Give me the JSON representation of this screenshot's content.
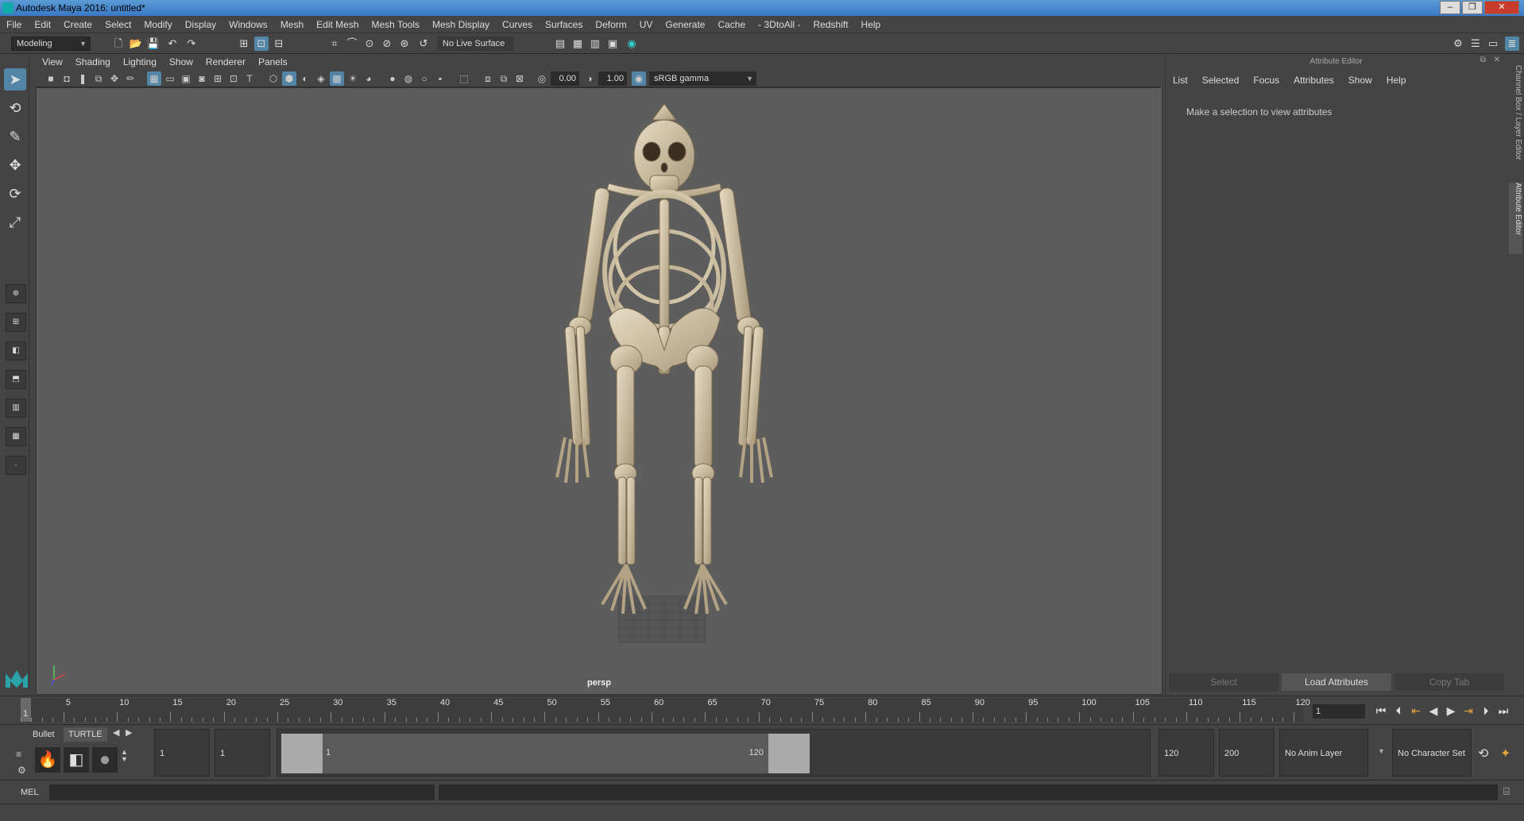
{
  "window": {
    "title": "Autodesk Maya 2016: untitled*"
  },
  "menubar": [
    "File",
    "Edit",
    "Create",
    "Select",
    "Modify",
    "Display",
    "Windows",
    "Mesh",
    "Edit Mesh",
    "Mesh Tools",
    "Mesh Display",
    "Curves",
    "Surfaces",
    "Deform",
    "UV",
    "Generate",
    "Cache",
    "- 3DtoAll -",
    "Redshift",
    "Help"
  ],
  "statusline": {
    "menuset": "Modeling",
    "live_surface": "No Live Surface"
  },
  "viewport": {
    "menus": [
      "View",
      "Shading",
      "Lighting",
      "Show",
      "Renderer",
      "Panels"
    ],
    "exposure": "0.00",
    "gamma": "1.00",
    "colorspace": "sRGB gamma",
    "camera_label": "persp"
  },
  "attribute_editor": {
    "title": "Attribute Editor",
    "menus": [
      "List",
      "Selected",
      "Focus",
      "Attributes",
      "Show",
      "Help"
    ],
    "message": "Make a selection to view attributes",
    "buttons": {
      "select": "Select",
      "load": "Load Attributes",
      "copy_tab": "Copy Tab"
    }
  },
  "side_tabs": {
    "channel_box": "Channel Box / Layer Editor",
    "attribute_editor": "Attribute Editor"
  },
  "timeslider": {
    "ticks": [
      "1",
      "5",
      "10",
      "15",
      "20",
      "25",
      "30",
      "35",
      "40",
      "45",
      "50",
      "55",
      "60",
      "65",
      "70",
      "75",
      "80",
      "85",
      "90",
      "95",
      "100",
      "105",
      "110",
      "115",
      "120"
    ],
    "current_frame": "1"
  },
  "shelf": {
    "tabs": [
      "Bullet",
      "TURTLE"
    ]
  },
  "range": {
    "start_frame": "1",
    "playback_start": "1",
    "range_start_label": "1",
    "range_end_label": "120",
    "playback_end": "120",
    "end_frame": "200",
    "anim_layer": "No Anim Layer",
    "character_set": "No Character Set"
  },
  "command_line": {
    "label": "MEL"
  }
}
